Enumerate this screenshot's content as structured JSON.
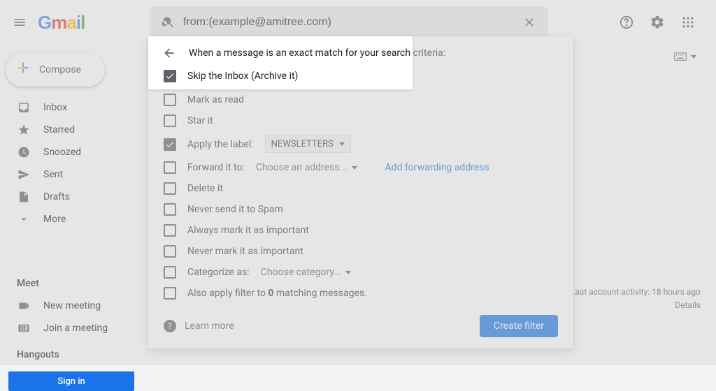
{
  "header": {
    "app_name": "Gmail",
    "search_value": "from:(example@amitree.com)"
  },
  "compose_label": "Compose",
  "sidebar": {
    "items": [
      {
        "label": "Inbox"
      },
      {
        "label": "Starred"
      },
      {
        "label": "Snoozed"
      },
      {
        "label": "Sent"
      },
      {
        "label": "Drafts"
      },
      {
        "label": "More"
      }
    ],
    "meet_title": "Meet",
    "meet_new": "New meeting",
    "meet_join": "Join a meeting",
    "hangouts_title": "Hangouts",
    "signin": "Sign in"
  },
  "filter": {
    "header_text": "When a message is an exact match for your search criteria:",
    "skip_inbox": "Skip the Inbox (Archive it)",
    "mark_read": "Mark as read",
    "star_it": "Star it",
    "apply_label_text": "Apply the label:",
    "apply_label_value": "NEWSLETTERS",
    "forward_text": "Forward it to:",
    "forward_placeholder": "Choose an address...",
    "add_forwarding": "Add forwarding address",
    "delete_it": "Delete it",
    "never_spam": "Never send it to Spam",
    "always_important": "Always mark it as important",
    "never_important": "Never mark it as important",
    "categorize_text": "Categorize as:",
    "categorize_placeholder": "Choose category...",
    "also_apply_prefix": "Also apply filter to ",
    "also_apply_count": "0",
    "also_apply_suffix": " matching messages.",
    "learn_more": "Learn more",
    "create_filter": "Create filter"
  },
  "footer": {
    "activity": "Last account activity: 18 hours ago",
    "details": "Details"
  }
}
